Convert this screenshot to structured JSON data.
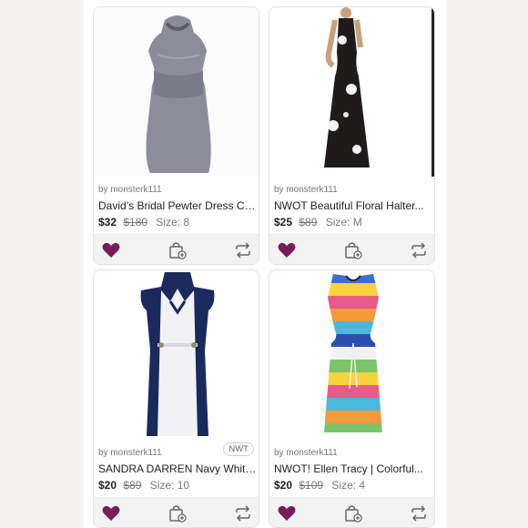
{
  "colors": {
    "like": "#7a1c5a",
    "icon": "#666666"
  },
  "listings": [
    {
      "seller": "by monsterk111",
      "title": "David’s Bridal Pewter Dress Cu...",
      "price": "$32",
      "original_price": "$180",
      "size": "Size: 8",
      "badge": null,
      "image_icon": "pewter-dress-photo"
    },
    {
      "seller": "by monsterk111",
      "title": "NWOT Beautiful Floral Halter...",
      "price": "$25",
      "original_price": "$89",
      "size": "Size: M",
      "badge": null,
      "image_icon": "floral-maxi-dress-photo"
    },
    {
      "seller": "by monsterk111",
      "title": "SANDRA DARREN Navy White...",
      "price": "$20",
      "original_price": "$89",
      "size": "Size: 10",
      "badge": "NWT",
      "image_icon": "navy-white-dress-photo"
    },
    {
      "seller": "by monsterk111",
      "title": "NWOT! Ellen Tracy | Colorful...",
      "price": "$20",
      "original_price": "$109",
      "size": "Size: 4",
      "badge": null,
      "image_icon": "striped-dress-photo"
    }
  ]
}
